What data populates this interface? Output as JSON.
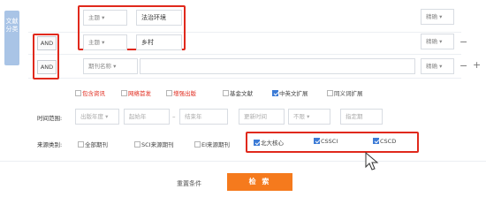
{
  "side_tab": {
    "label": "文献分类"
  },
  "rows": [
    {
      "logic": "",
      "field": "主题",
      "value": "法治环境",
      "match": "精确"
    },
    {
      "logic": "AND",
      "field": "主题",
      "value": "乡村",
      "match": "精确"
    },
    {
      "logic": "AND",
      "field": "期刊名称",
      "value": "",
      "match": "精确"
    }
  ],
  "controls": {
    "minus": "−",
    "plus": "+"
  },
  "options": [
    {
      "label": "包含资讯",
      "checked": false,
      "color": "red"
    },
    {
      "label": "网络首发",
      "checked": false,
      "color": "red"
    },
    {
      "label": "增强出版",
      "checked": false,
      "color": "red"
    },
    {
      "label": "基金文献",
      "checked": false,
      "color": "normal"
    },
    {
      "label": "中英文扩展",
      "checked": true,
      "color": "normal"
    },
    {
      "label": "同义词扩展",
      "checked": false,
      "color": "normal"
    }
  ],
  "time_range": {
    "label": "时间范围:",
    "publish_year": "出版年度",
    "start_year": "起始年",
    "end_year": "结束年",
    "update_time_label": "更新时间",
    "update_time_value": "不限",
    "specify_period": "指定期"
  },
  "source_category": {
    "label": "来源类别:",
    "items": [
      {
        "label": "全部期刊",
        "checked": false
      },
      {
        "label": "SCI来源期刊",
        "checked": false
      },
      {
        "label": "EI来源期刊",
        "checked": false
      },
      {
        "label": "北大核心",
        "checked": true
      },
      {
        "label": "CSSCI",
        "checked": true
      },
      {
        "label": "CSCD",
        "checked": true
      }
    ]
  },
  "actions": {
    "reset": "重置条件",
    "search": "检 索"
  },
  "colors": {
    "accent": "#f57a1d",
    "highlight": "#e0291c",
    "check": "#3c7bd6"
  }
}
